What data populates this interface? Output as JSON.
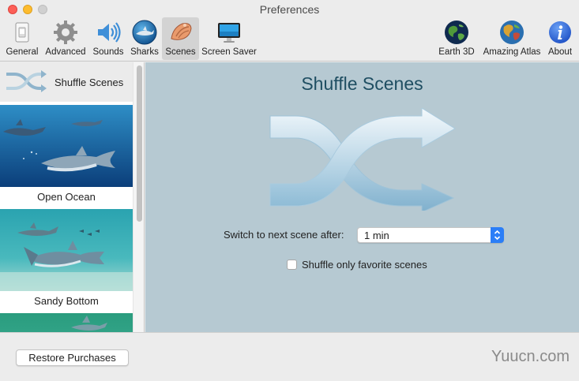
{
  "window": {
    "title": "Preferences"
  },
  "toolbar": {
    "items": [
      {
        "label": "General",
        "icon": "light-switch-icon"
      },
      {
        "label": "Advanced",
        "icon": "gear-icon"
      },
      {
        "label": "Sounds",
        "icon": "speaker-icon"
      },
      {
        "label": "Sharks",
        "icon": "shark-icon"
      },
      {
        "label": "Scenes",
        "icon": "conch-shell-icon",
        "selected": true
      },
      {
        "label": "Screen Saver",
        "icon": "monitor-icon"
      },
      {
        "label": "Earth 3D",
        "icon": "globe-icon"
      },
      {
        "label": "Amazing Atlas",
        "icon": "atlas-globe-icon"
      },
      {
        "label": "About",
        "icon": "info-icon"
      }
    ]
  },
  "sidebar": {
    "shuffle_label": "Shuffle Scenes",
    "scenes": [
      {
        "label": "Open Ocean"
      },
      {
        "label": "Sandy Bottom"
      },
      {
        "label": ""
      }
    ]
  },
  "main": {
    "title": "Shuffle Scenes",
    "switch_label": "Switch to next scene after:",
    "switch_value": "1 min",
    "favorite_label": "Shuffle only favorite scenes",
    "favorite_checked": false
  },
  "bottom": {
    "restore_label": "Restore Purchases",
    "watermark": "Yuucn.com"
  },
  "colors": {
    "main_bg": "#b6c9d2",
    "title_color": "#1f4e62",
    "accent": "#2b7ef7",
    "selected_tab_bg": "#d3d3d3"
  }
}
